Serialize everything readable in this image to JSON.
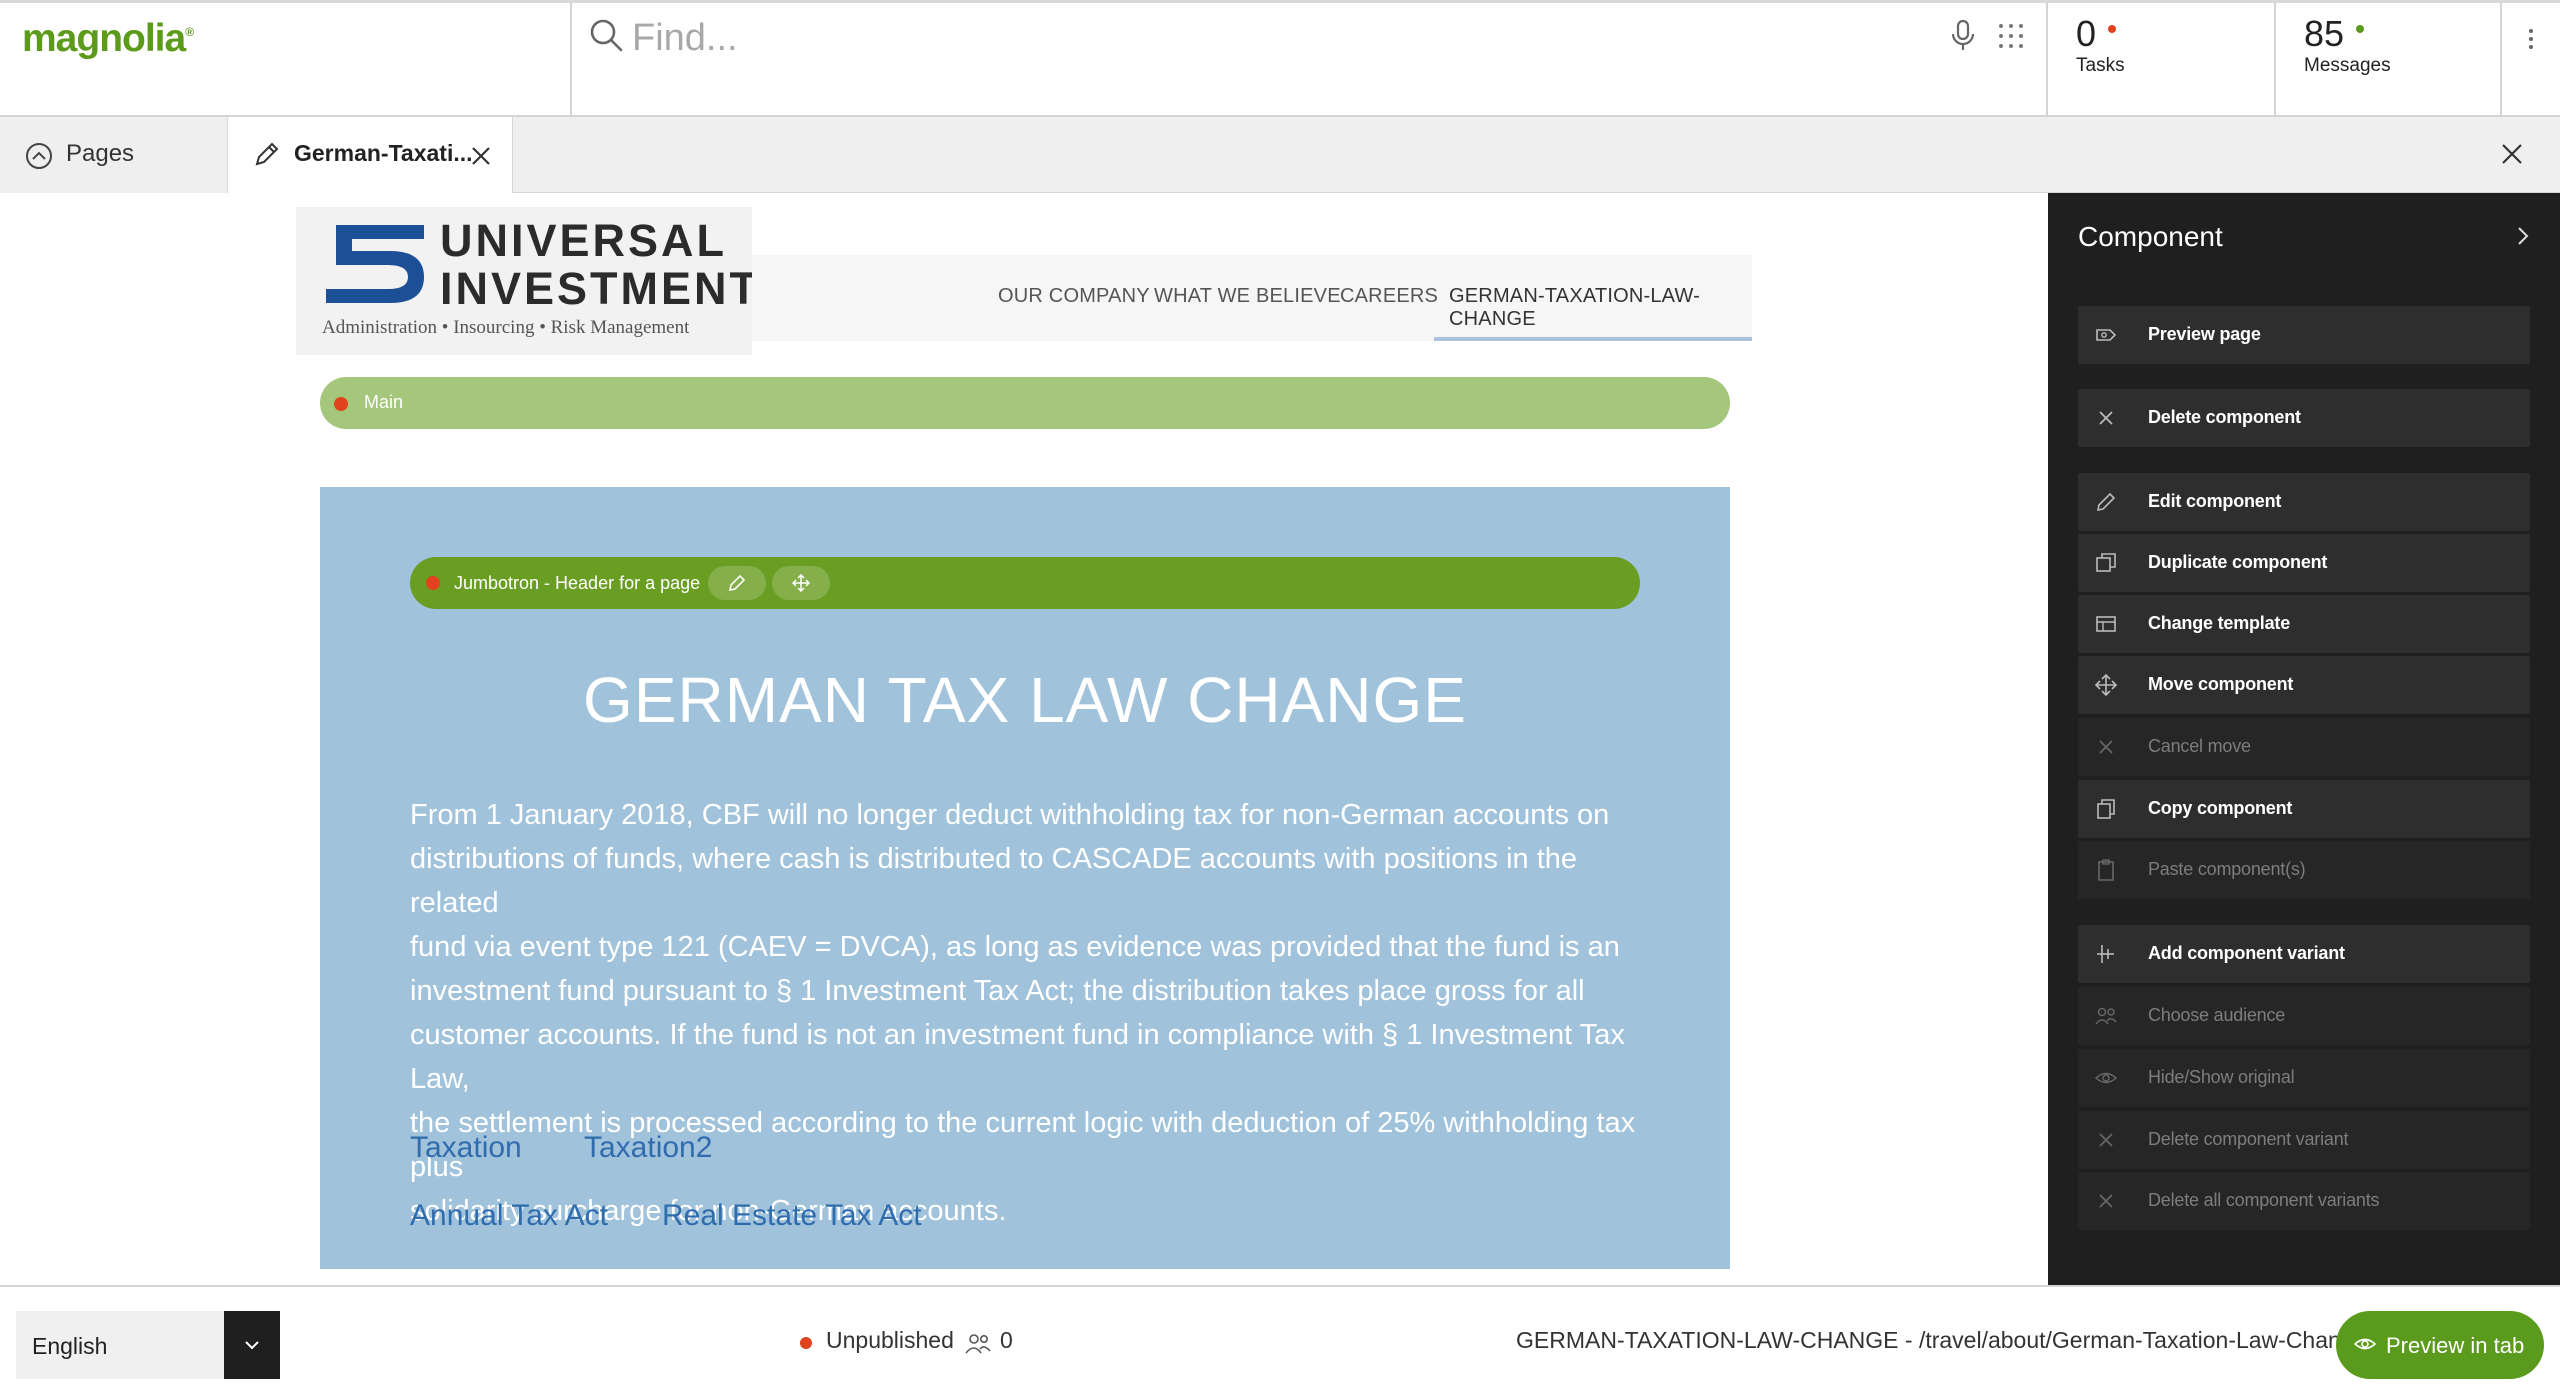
{
  "app": {
    "logo_text": "magnolia",
    "logo_mark": "®",
    "search_placeholder": "Find...",
    "tasks": {
      "count": "0",
      "label": "Tasks",
      "dot_color": "#e0431e"
    },
    "messages": {
      "count": "85",
      "label": "Messages",
      "dot_color": "#5a9a1c"
    }
  },
  "tabs": {
    "pages_label": "Pages",
    "active_label": "German-Taxati..."
  },
  "site": {
    "brand_line1": "UNIVERSAL",
    "brand_line2": "INVESTMENT",
    "brand_tagline": "Administration • Insourcing • Risk Management",
    "nav": [
      "OUR COMPANY",
      "WHAT WE BELIEVE",
      "CAREERS",
      "GERMAN-TAXATION-LAW-CHANGE"
    ],
    "area_label": "Main",
    "component_label": "Jumbotron - Header for a page",
    "title": "GERMAN TAX LAW CHANGE",
    "body_lines": [
      "From 1 January 2018, CBF will no longer deduct withholding tax for non-German accounts on",
      "distributions of funds, where cash is distributed to CASCADE accounts with positions in the related",
      "fund via event type 121 (CAEV = DVCA), as long as evidence was provided that the fund is an",
      "investment fund pursuant to § 1 Investment Tax Act; the distribution takes place gross for all",
      "customer accounts. If the fund is not an investment fund in compliance with § 1 Investment Tax Law,",
      "the settlement is processed according to the current logic with deduction of 25% withholding tax plus",
      "solidarity surcharge for non-German accounts."
    ],
    "links": [
      "Taxation",
      "Taxation2",
      "Annual Tax Act",
      "Real Estate Tax Act"
    ]
  },
  "panel": {
    "title": "Component",
    "actions": [
      {
        "label": "Preview page",
        "icon": "preview-icon",
        "enabled": true
      },
      {
        "label": "Delete component",
        "icon": "close-icon",
        "enabled": true
      },
      {
        "label": "Edit component",
        "icon": "pencil-icon",
        "enabled": true
      },
      {
        "label": "Duplicate component",
        "icon": "duplicate-icon",
        "enabled": true
      },
      {
        "label": "Change template",
        "icon": "template-icon",
        "enabled": true
      },
      {
        "label": "Move component",
        "icon": "move-icon",
        "enabled": true
      },
      {
        "label": "Cancel move",
        "icon": "close-icon",
        "enabled": false
      },
      {
        "label": "Copy component",
        "icon": "copy-icon",
        "enabled": true
      },
      {
        "label": "Paste component(s)",
        "icon": "clipboard-icon",
        "enabled": false
      },
      {
        "label": "Add component variant",
        "icon": "variant-icon",
        "enabled": true
      },
      {
        "label": "Choose audience",
        "icon": "audience-icon",
        "enabled": false
      },
      {
        "label": "Hide/Show original",
        "icon": "eye-icon",
        "enabled": false
      },
      {
        "label": "Delete component variant",
        "icon": "close-icon",
        "enabled": false
      },
      {
        "label": "Delete all component variants",
        "icon": "close-icon",
        "enabled": false
      }
    ]
  },
  "status": {
    "language": "English",
    "publish_state": "Unpublished",
    "audience_count": "0",
    "path": "GERMAN-TAXATION-LAW-CHANGE - /travel/about/German-Taxation-Law-Change",
    "preview_label": "Preview in tab"
  },
  "colors": {
    "brand_green": "#5a9a1c",
    "area_bar": "#a5c77b",
    "component_bar": "#6a9e23",
    "jumbotron_bg": "#a0c2db",
    "link_blue": "#2f6cae",
    "panel_bg": "#1f1f1f",
    "status_red": "#e0431e"
  }
}
